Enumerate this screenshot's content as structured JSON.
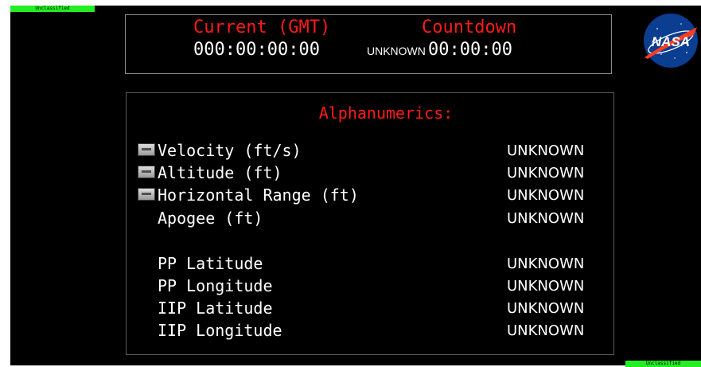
{
  "classification": {
    "top": "Unclassified",
    "bottom": "Unclassified"
  },
  "time_panel": {
    "current_label": "Current (GMT)",
    "current_value": "000:00:00:00",
    "countdown_label": "Countdown",
    "countdown_status": "UNKNOWN",
    "countdown_value": "00:00:00"
  },
  "logo": {
    "text": "NASA",
    "colors": {
      "circle": "#0b3d91",
      "chevron": "#fc3d21"
    }
  },
  "alphanumerics": {
    "title": "Alphanumerics:",
    "rows": [
      {
        "label": "Velocity (ft/s)",
        "value": "UNKNOWN",
        "has_icon": true
      },
      {
        "label": "Altitude (ft)",
        "value": "UNKNOWN",
        "has_icon": true
      },
      {
        "label": "Horizontal Range (ft)",
        "value": "UNKNOWN",
        "has_icon": true
      },
      {
        "label": "Apogee (ft)",
        "value": "UNKNOWN",
        "has_icon": false
      },
      {
        "label": "PP Latitude",
        "value": "UNKNOWN",
        "has_icon": false
      },
      {
        "label": "PP Longitude",
        "value": "UNKNOWN",
        "has_icon": false
      },
      {
        "label": "IIP Latitude",
        "value": "UNKNOWN",
        "has_icon": false
      },
      {
        "label": "IIP Longitude",
        "value": "UNKNOWN",
        "has_icon": false
      }
    ]
  },
  "colors": {
    "background": "#000000",
    "label": "#ff1a1a",
    "text": "#ffffff",
    "banner": "#22ee22"
  }
}
